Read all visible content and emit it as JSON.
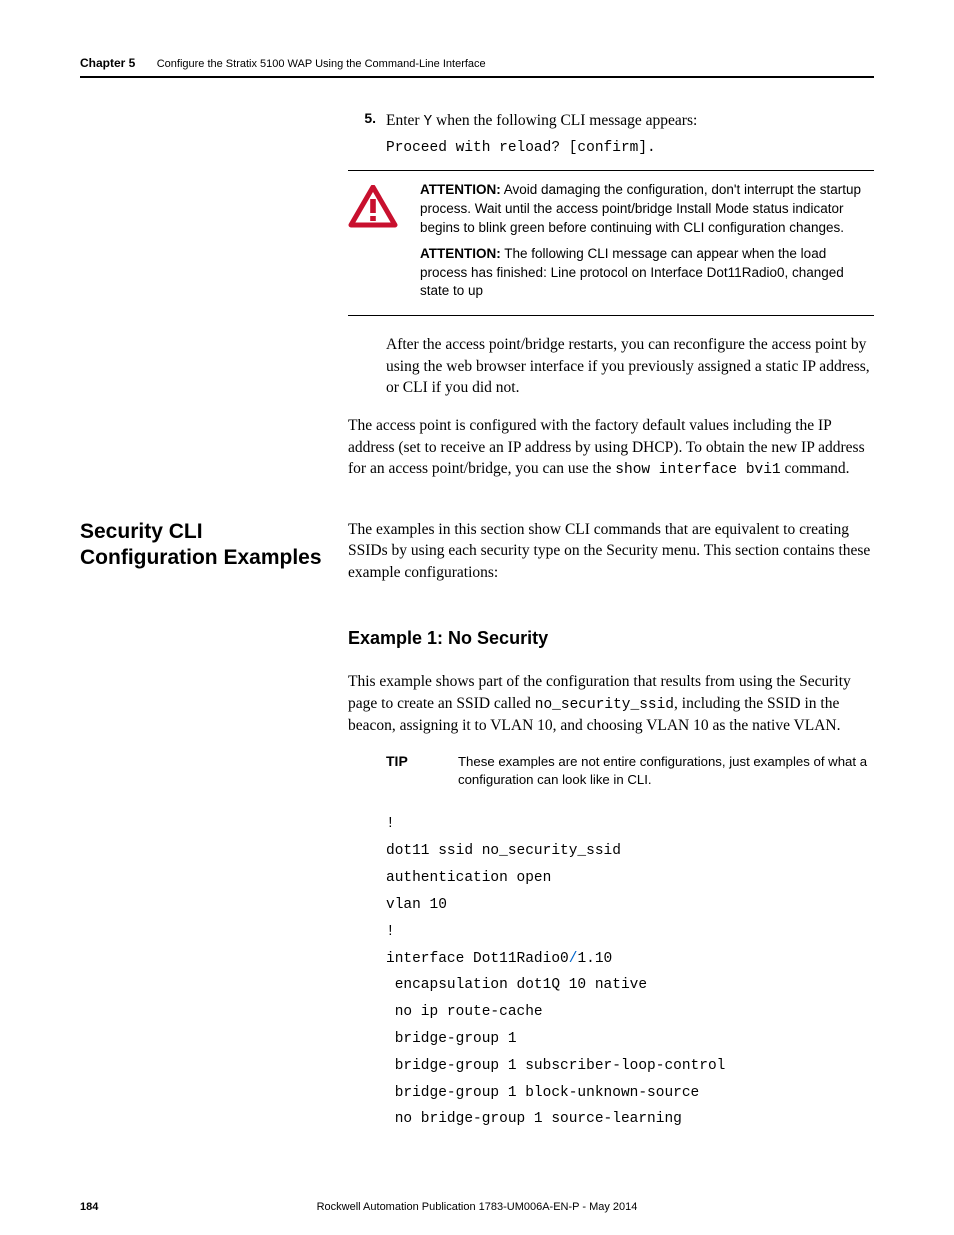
{
  "header": {
    "chapter": "Chapter 5",
    "title": "Configure the Stratix 5100 WAP Using the Command-Line Interface"
  },
  "step5": {
    "num": "5.",
    "text_a": "Enter ",
    "text_y": "Y",
    "text_b": " when the following CLI message appears:",
    "cli": "Proceed with reload? [confirm]."
  },
  "attention": {
    "label": "ATTENTION:",
    "p1": " Avoid damaging the configuration, don't interrupt the startup process. Wait until the access point/bridge Install Mode status indicator begins to blink green before continuing with CLI configuration changes.",
    "p2": " The following CLI message can appear when the load process has finished: Line protocol on Interface Dot11Radio0, changed state to up"
  },
  "para_after_restart": "After the access point/bridge restarts, you can reconfigure the access point by using the web browser interface if you previously assigned a static IP address, or CLI if you did not.",
  "para_factory_a": "The access point is configured with the factory default values including the IP address (set to receive an IP address by using DHCP). To obtain the new IP address for an access point/bridge, you can use the ",
  "para_factory_cmd": "show interface bvi1",
  "para_factory_b": " command.",
  "section": {
    "heading": "Security CLI Configuration Examples",
    "intro": "The examples in this section show CLI commands that are equivalent to creating SSIDs by using each security type on the Security menu. This section contains these example configurations:"
  },
  "example1": {
    "heading": "Example 1: No Security",
    "para_a": "This example shows part of the configuration that results from using the Security page to create an SSID called ",
    "para_ssid": "no_security_ssid",
    "para_b": ", including the SSID in the beacon, assigning it to VLAN 10, and choosing VLAN 10 as the native VLAN.",
    "tip_label": "TIP",
    "tip_text": "These examples are not entire configurations, just examples of what a configuration can look like in CLI.",
    "code": {
      "l1": "!",
      "l2": "dot11 ssid no_security_ssid",
      "l3": "authentication open",
      "l4": "vlan 10",
      "l5": "!",
      "l6a": "interface Dot11Radio0",
      "l6slash": "/",
      "l6b": "1.10",
      "l7": " encapsulation dot1Q 10 native",
      "l8": " no ip route-cache",
      "l9": " bridge-group 1",
      "l10": " bridge-group 1 subscriber-loop-control",
      "l11": " bridge-group 1 block-unknown-source",
      "l12": " no bridge-group 1 source-learning"
    }
  },
  "footer": {
    "page": "184",
    "pub": "Rockwell Automation Publication 1783-UM006A-EN-P - May 2014"
  }
}
